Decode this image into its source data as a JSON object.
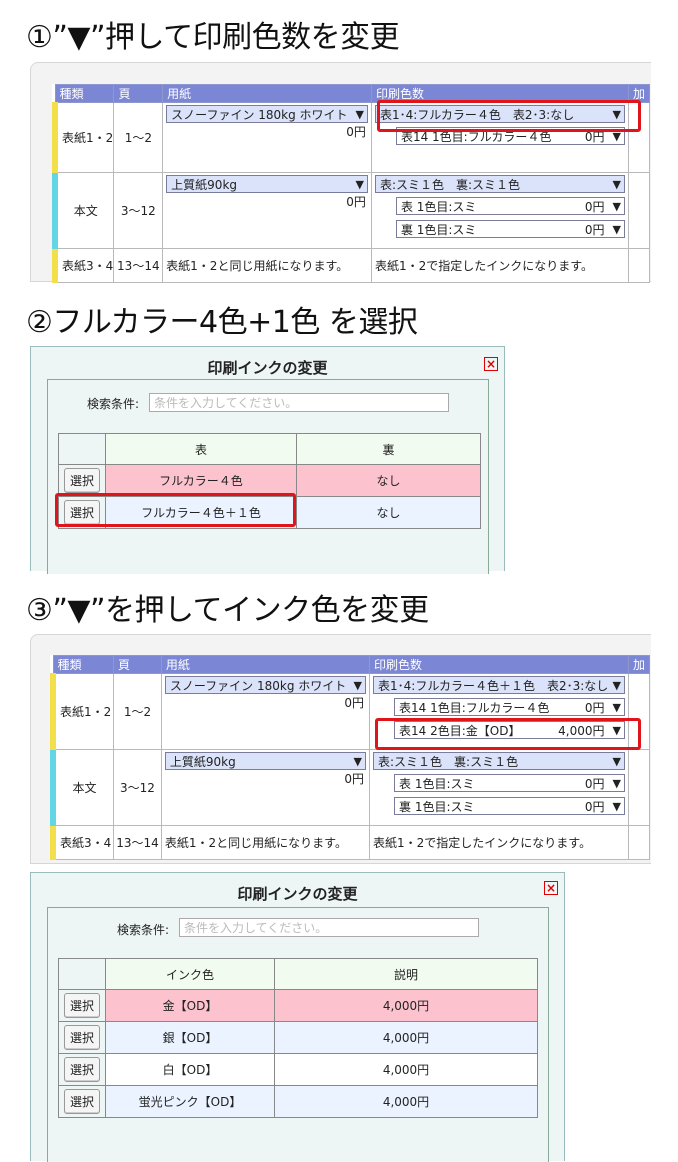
{
  "steps": [
    "①”▼”押して印刷色数を変更",
    "②フルカラー4色+1色 を選択",
    "③”▼”を押してインク色を変更"
  ],
  "headers": [
    "種類",
    "頁",
    "用紙",
    "印刷色数",
    "加"
  ],
  "spec1": {
    "cover": {
      "type": "表紙1・2",
      "pages": "1～2",
      "paper": "スノーファイン 180kg ホワイト",
      "paper_price": "0円",
      "colors": "表1･4:フルカラー４色　表2･3:なし",
      "sub1": "表14 1色目:フルカラー４色",
      "sub1_price": "0円"
    },
    "body": {
      "type": "本文",
      "pages": "3～12",
      "paper": "上質紙90kg",
      "paper_price": "0円",
      "colors": "表:スミ１色　裏:スミ１色",
      "sub1": "表 1色目:スミ",
      "sub1_price": "0円",
      "sub2": "裏 1色目:スミ",
      "sub2_price": "0円"
    },
    "back": {
      "type": "表紙3・4",
      "pages": "13～14",
      "paper": "表紙1・2と同じ用紙になります。",
      "colors": "表紙1・2で指定したインクになります。"
    }
  },
  "spec2": {
    "cover": {
      "type": "表紙1・2",
      "pages": "1～2",
      "paper": "スノーファイン 180kg ホワイト",
      "paper_price": "0円",
      "colors": "表1･4:フルカラー４色＋１色　表2･3:なし",
      "sub1": "表14 1色目:フルカラー４色",
      "sub1_price": "0円",
      "sub2": "表14 2色目:金【OD】",
      "sub2_price": "4,000円"
    },
    "body": {
      "type": "本文",
      "pages": "3～12",
      "paper": "上質紙90kg",
      "paper_price": "0円",
      "colors": "表:スミ１色　裏:スミ１色",
      "sub1": "表 1色目:スミ",
      "sub1_price": "0円",
      "sub2": "裏 1色目:スミ",
      "sub2_price": "0円"
    },
    "back": {
      "type": "表紙3・4",
      "pages": "13～14",
      "paper": "表紙1・2と同じ用紙になります。",
      "colors": "表紙1・2で指定したインクになります。"
    }
  },
  "dialog1": {
    "title": "印刷インクの変更",
    "search_label": "検索条件:",
    "search_placeholder": "条件を入力してください。",
    "col_front": "表",
    "col_back": "裏",
    "pick": "選択",
    "rows": [
      {
        "front": "フルカラー４色",
        "back": "なし"
      },
      {
        "front": "フルカラー４色＋１色",
        "back": "なし"
      }
    ]
  },
  "dialog2": {
    "title": "印刷インクの変更",
    "search_label": "検索条件:",
    "search_placeholder": "条件を入力してください。",
    "col_ink": "インク色",
    "col_desc": "説明",
    "pick": "選択",
    "rows": [
      {
        "ink": "金【OD】",
        "desc": "4,000円"
      },
      {
        "ink": "銀【OD】",
        "desc": "4,000円"
      },
      {
        "ink": "白【OD】",
        "desc": "4,000円"
      },
      {
        "ink": "蛍光ピンク【OD】",
        "desc": "4,000円"
      }
    ]
  },
  "icons": {
    "dropdown": "dropdown-arrow-icon",
    "close": "close-x-icon"
  },
  "colors": {
    "header": "#7b86d4",
    "highlight": "#e0141b",
    "yellow_bar": "#f2df4a",
    "cyan_bar": "#63d6e6",
    "selected_row": "#fcc3cf"
  }
}
